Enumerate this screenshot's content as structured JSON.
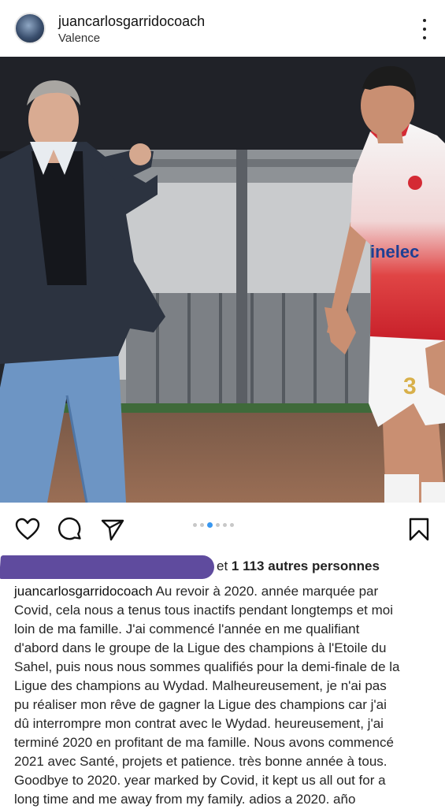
{
  "post": {
    "username": "juancarlosgarridocoach",
    "location": "Valence"
  },
  "photo": {
    "jersey_sponsor": "inelec",
    "jersey_number": "3"
  },
  "carousel": {
    "total": 6,
    "active_index": 2
  },
  "likes": {
    "prefix": "et ",
    "count_text": "1 113 autres personnes"
  },
  "caption": {
    "username": "juancarlosgarridocoach",
    "lines": [
      " Au revoir à 2020. année marquée par",
      "Covid, cela nous a tenus tous inactifs pendant longtemps et moi",
      "loin de ma famille.  J'ai commencé l'année en me qualifiant",
      "d'abord dans le groupe de la Ligue des champions à l'Etoile du",
      "Sahel, puis nous nous sommes qualifiés pour la demi-finale de la",
      "Ligue des champions au Wydad.  Malheureusement, je n'ai pas",
      "pu réaliser mon rêve de gagner la Ligue des champions car j'ai",
      "dû interrompre mon contrat avec le Wydad.  heureusement, j'ai",
      "terminé 2020 en profitant de ma famille.  Nous avons commencé",
      "2021 avec Santé, projets et patience.  très bonne année à tous.",
      "Goodbye to 2020. year marked by Covid, it kept us all out for a",
      "long time and me away from my family.  adios a 2020. año"
    ]
  }
}
